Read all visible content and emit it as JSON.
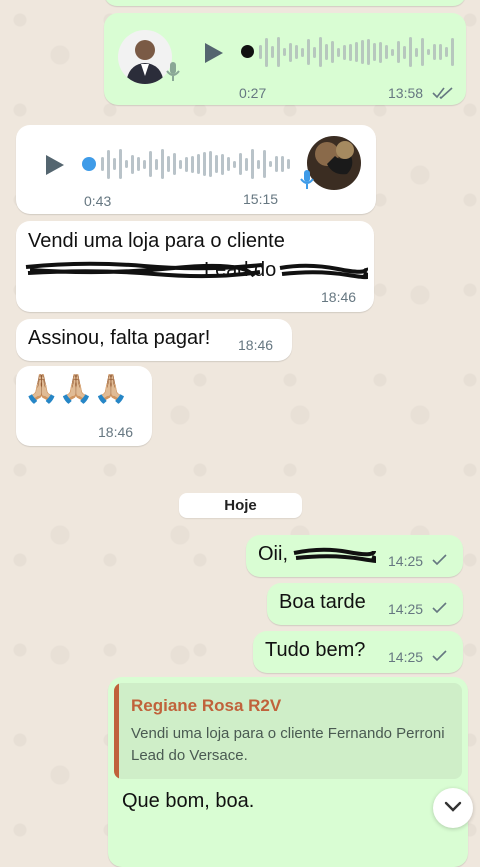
{
  "chat": {
    "messages": [
      {
        "type": "audio",
        "direction": "outgoing",
        "duration": "0:27",
        "time": "13:58",
        "status": "read",
        "progress": 0.0
      },
      {
        "type": "audio",
        "direction": "incoming",
        "duration": "0:43",
        "time": "15:15",
        "progress": 0.0
      },
      {
        "type": "text",
        "direction": "incoming",
        "line1": "Vendi uma loja para o cliente",
        "line2_visible": "Lead do",
        "line2_end": ".",
        "time": "18:46"
      },
      {
        "type": "text",
        "direction": "incoming",
        "text": "Assinou, falta pagar!",
        "time": "18:46"
      },
      {
        "type": "text",
        "direction": "incoming",
        "text": "🙏🏼🙏🏼🙏🏼",
        "time": "18:46"
      },
      {
        "type": "text",
        "direction": "outgoing",
        "text": "Oii,",
        "time": "14:25",
        "status": "sent"
      },
      {
        "type": "text",
        "direction": "outgoing",
        "text": "Boa tarde",
        "time": "14:25",
        "status": "sent"
      },
      {
        "type": "text",
        "direction": "outgoing",
        "text": "Tudo bem?",
        "time": "14:25",
        "status": "sent"
      },
      {
        "type": "reply",
        "direction": "outgoing",
        "quote_author": "Regiane Rosa R2V",
        "quote_text": "Vendi uma loja para o cliente Fernando Perroni Lead do Versace.",
        "text": "Que bom, boa."
      }
    ],
    "date_separator": "Hoje"
  },
  "icons": {
    "play": "play-icon",
    "mic": "mic-icon",
    "read_ticks": "double-check-icon",
    "sent_tick": "check-icon",
    "scroll_down": "chevron-down-icon"
  },
  "colors": {
    "outgoing_bubble": "#d9fdd3",
    "incoming_bubble": "#ffffff",
    "quote_accent": "#c0623b",
    "mic_blue": "#3e9be8"
  }
}
